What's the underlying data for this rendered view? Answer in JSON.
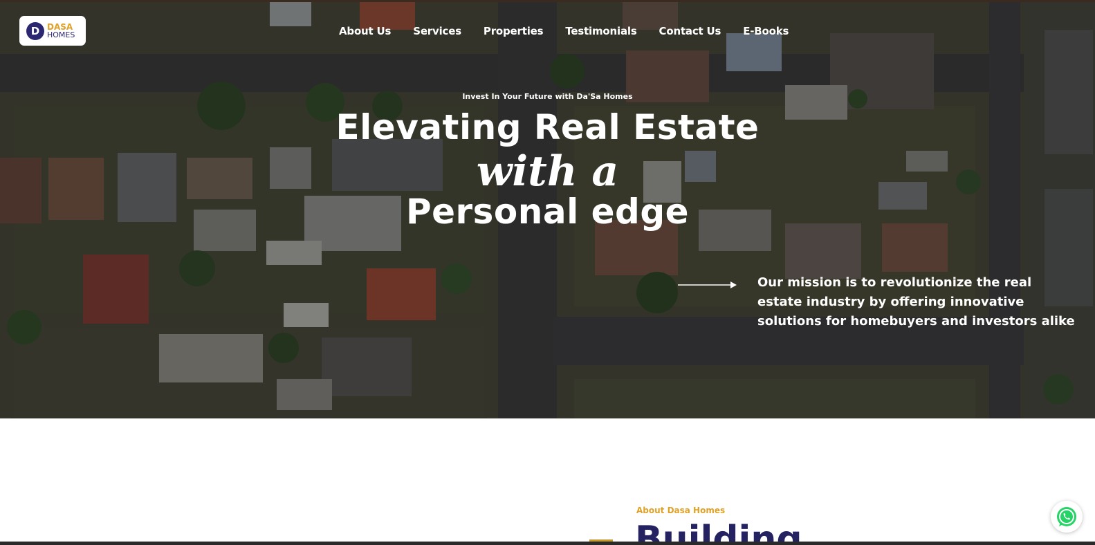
{
  "brand": {
    "line1": "DASA",
    "line2": "HOMES",
    "mark": "D"
  },
  "nav": {
    "items": [
      "About Us",
      "Services",
      "Properties",
      "Testimonials",
      "Contact Us",
      "E-Books"
    ]
  },
  "hero": {
    "eyebrow": "Invest In Your Future with Da'Sa Homes",
    "headline_line1": "Elevating Real Estate",
    "headline_line2": "with a",
    "headline_line3": "Personal edge",
    "mission": "Our mission is to revolutionize the real estate industry by offering innovative solutions for homebuyers and investors alike"
  },
  "about": {
    "label": "About Dasa Homes",
    "heading": "Building"
  },
  "icons": {
    "whatsapp": "whatsapp-icon",
    "arrow": "arrow-right-icon"
  },
  "colors": {
    "accent_gold": "#e0a127",
    "brand_navy": "#252262",
    "whatsapp_green": "#25d366"
  }
}
